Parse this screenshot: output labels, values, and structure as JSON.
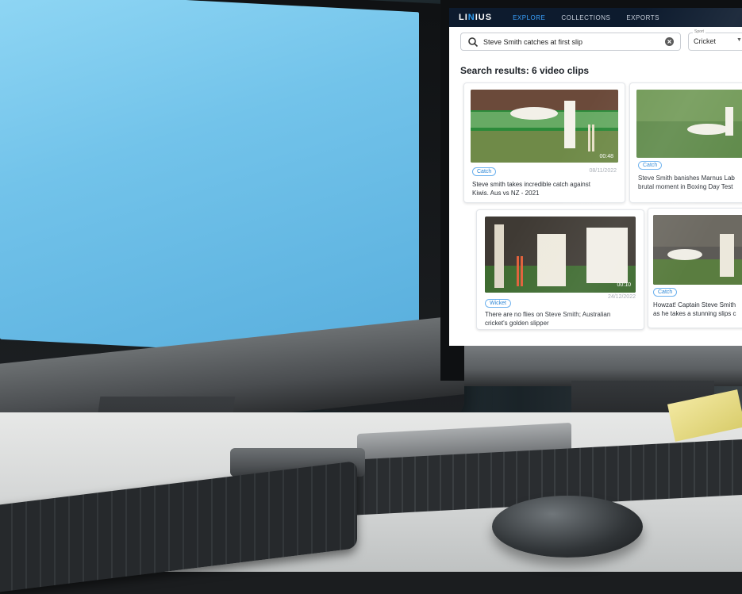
{
  "app": {
    "logo": {
      "text_left": "LI",
      "text_mid": "N",
      "text_right": "IUS"
    },
    "nav": {
      "tabs": [
        {
          "label": "EXPLORE",
          "active": true
        },
        {
          "label": "COLLECTIONS",
          "active": false
        },
        {
          "label": "EXPORTS",
          "active": false
        }
      ]
    },
    "search": {
      "value": "Steve Smith catches at first slip",
      "icon": "search-icon",
      "clear_icon": "clear-icon"
    },
    "sport_filter": {
      "label": "Sport",
      "value": "Cricket"
    },
    "results_heading": "Search results:  6 video clips",
    "clips": [
      {
        "tag": "Catch",
        "date": "08/11/2022",
        "duration": "00:48",
        "title_line1": "Steve smith takes incredible catch against",
        "title_line2": "Kiwis. Aus vs NZ - 2021"
      },
      {
        "tag": "Catch",
        "date": "",
        "duration": "",
        "title_line1": "Steve Smith banishes Marnus Lab",
        "title_line2": "brutal moment in Boxing Day Test"
      },
      {
        "tag": "Wicket",
        "date": "24/12/2022",
        "duration": "00:10",
        "title_line1": "There are no flies on Steve Smith; Australian",
        "title_line2": "cricket's golden slipper"
      },
      {
        "tag": "Catch",
        "date": "",
        "duration": "",
        "title_line1": "Howzat! Captain Steve Smith",
        "title_line2": "as he takes a stunning slips c"
      }
    ],
    "colors": {
      "topbar": "#0d1b2e",
      "accent": "#3aa2ff",
      "tag": "#2b86d6"
    }
  }
}
